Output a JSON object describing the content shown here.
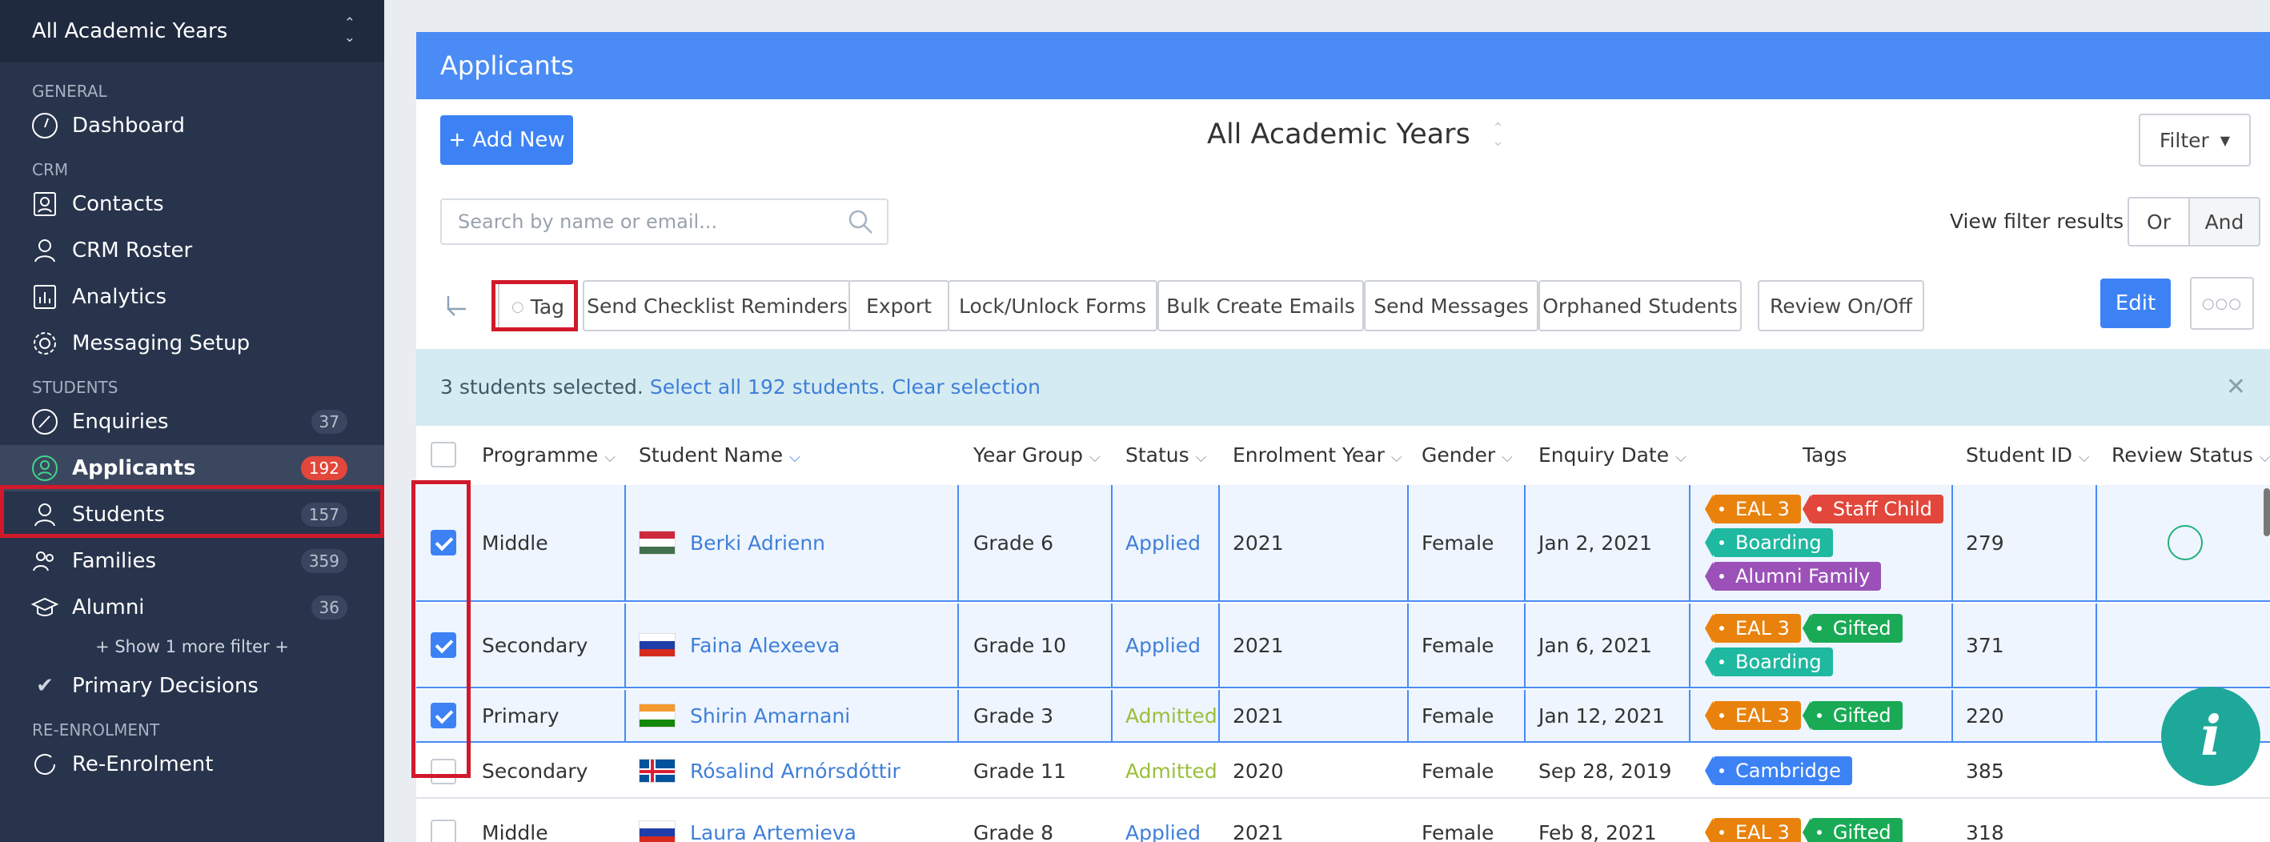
{
  "sidebar": {
    "year_selector": "All Academic Years",
    "sections": {
      "general": "GENERAL",
      "crm": "CRM",
      "students": "STUDENTS",
      "reenrolment": "RE-ENROLMENT"
    },
    "items": {
      "dashboard": "Dashboard",
      "contacts": "Contacts",
      "crm_roster": "CRM Roster",
      "analytics": "Analytics",
      "messaging_setup": "Messaging Setup",
      "enquiries": "Enquiries",
      "enquiries_count": "37",
      "applicants": "Applicants",
      "applicants_count": "192",
      "students": "Students",
      "students_count": "157",
      "families": "Families",
      "families_count": "359",
      "alumni": "Alumni",
      "alumni_count": "36",
      "show_more": "+ Show 1 more filter +",
      "primary_decisions": "Primary Decisions",
      "reenrolment": "Re-Enrolment"
    }
  },
  "header": {
    "title": "Applicants"
  },
  "toolbar": {
    "add_new": "+ Add New",
    "year_title": "All Academic Years",
    "filter": "Filter",
    "search_placeholder": "Search by name or email...",
    "view_filter_label": "View filter results as:",
    "or": "Or",
    "and": "And",
    "actions": [
      "Tag",
      "Send Checklist Reminders",
      "Export",
      "Lock/Unlock Forms",
      "Bulk Create Emails",
      "Send Messages",
      "Orphaned Students",
      "Review On/Off"
    ],
    "edit": "Edit",
    "more": "○○○"
  },
  "selection": {
    "text": "3 students selected.",
    "select_all": "Select all 192 students.",
    "clear": "Clear selection"
  },
  "table": {
    "columns": [
      "Programme",
      "Student Name",
      "Year Group",
      "Status",
      "Enrolment Year",
      "Gender",
      "Enquiry Date",
      "Tags",
      "Student ID",
      "Review Status"
    ],
    "rows": [
      {
        "programme": "Middle",
        "name": "Berki Adrienn",
        "flag": "hungary",
        "year_group": "Grade 6",
        "status": "Applied",
        "enrolment_year": "2021",
        "gender": "Female",
        "enquiry_date": "Jan 2, 2021",
        "student_id": "279",
        "selected": true
      },
      {
        "programme": "Secondary",
        "name": "Faina Alexeeva",
        "flag": "russia",
        "year_group": "Grade 10",
        "status": "Applied",
        "enrolment_year": "2021",
        "gender": "Female",
        "enquiry_date": "Jan 6, 2021",
        "student_id": "371",
        "selected": true
      },
      {
        "programme": "Primary",
        "name": "Shirin Amarnani",
        "flag": "india",
        "year_group": "Grade 3",
        "status": "Admitted",
        "enrolment_year": "2021",
        "gender": "Female",
        "enquiry_date": "Jan 12, 2021",
        "student_id": "220",
        "selected": true
      },
      {
        "programme": "Secondary",
        "name": "Rósalind Arnórsdóttir",
        "flag": "iceland",
        "year_group": "Grade 11",
        "status": "Admitted",
        "enrolment_year": "2020",
        "gender": "Female",
        "enquiry_date": "Sep 28, 2019",
        "student_id": "385",
        "selected": false
      },
      {
        "programme": "Middle",
        "name": "Laura Artemieva",
        "flag": "russia",
        "year_group": "Grade 8",
        "status": "Applied",
        "enrolment_year": "2021",
        "gender": "Female",
        "enquiry_date": "Feb 8, 2021",
        "student_id": "318",
        "selected": false
      }
    ],
    "tags": {
      "eal3": "EAL 3",
      "staff_child": "Staff Child",
      "boarding": "Boarding",
      "alumni_family": "Alumni Family",
      "gifted": "Gifted",
      "cambridge": "Cambridge"
    }
  },
  "colors": {
    "sidebar_bg": "#28344c",
    "header_blue": "#4a8bf5",
    "badge_red": "#e3463a",
    "tag_orange": "#e8820c",
    "tag_red": "#e3463a",
    "tag_green": "#1aaa55",
    "tag_teal": "#1fb8a0",
    "tag_purple": "#9b51b8",
    "tag_blue": "#3c82f5",
    "highlight_red": "#d0192a"
  },
  "fab": {
    "label": "i"
  }
}
